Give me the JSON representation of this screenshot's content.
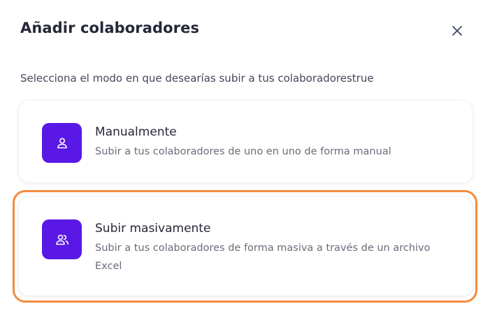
{
  "dialog": {
    "title": "Añadir colaboradores",
    "subtitle": "Selecciona el modo en que desearías subir a tus colaboradorestrue",
    "close_icon": "close-icon"
  },
  "options": [
    {
      "title": "Manualmente",
      "description": "Subir a tus colaboradores de uno en uno de forma manual",
      "icon": "user-icon"
    },
    {
      "title": "Subir masivamente",
      "description": "Subir a tus colaboradores de forma masiva a través de un archivo Excel",
      "icon": "users-icon"
    }
  ],
  "colors": {
    "accent": "#5a18e6",
    "highlight": "#f58a3d",
    "title": "#262838",
    "muted": "#6a6c7a"
  }
}
